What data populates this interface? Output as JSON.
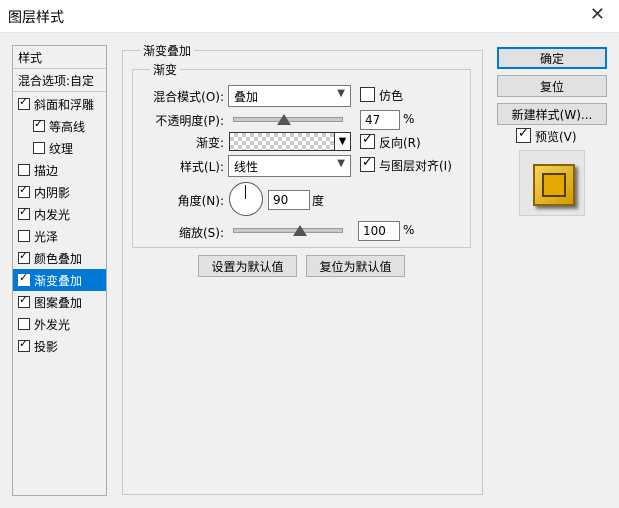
{
  "window": {
    "title": "图层样式",
    "close_icon": "close-icon"
  },
  "left": {
    "header": "样式",
    "blend_options": "混合选项:自定",
    "items": [
      {
        "label": "斜面和浮雕",
        "checked": true
      },
      {
        "label": "等高线",
        "checked": true
      },
      {
        "label": "纹理",
        "checked": false
      },
      {
        "label": "描边",
        "checked": false
      },
      {
        "label": "内阴影",
        "checked": true
      },
      {
        "label": "内发光",
        "checked": true
      },
      {
        "label": "光泽",
        "checked": false
      },
      {
        "label": "颜色叠加",
        "checked": true
      },
      {
        "label": "渐变叠加",
        "checked": true
      },
      {
        "label": "图案叠加",
        "checked": true
      },
      {
        "label": "外发光",
        "checked": false
      },
      {
        "label": "投影",
        "checked": true
      }
    ]
  },
  "main": {
    "outer_group": "渐变叠加",
    "inner_group": "渐变",
    "blend_mode_label": "混合模式(O):",
    "blend_mode_value": "叠加",
    "dither_label": "仿色",
    "opacity_label": "不透明度(P):",
    "opacity_value": "47",
    "opacity_unit": "%",
    "gradient_label": "渐变:",
    "reverse_label": "反向(R)",
    "style_label": "样式(L):",
    "style_value": "线性",
    "align_label": "与图层对齐(I)",
    "angle_label": "角度(N):",
    "angle_value": "90",
    "angle_unit": "度",
    "scale_label": "缩放(S):",
    "scale_value": "100",
    "scale_unit": "%",
    "set_default": "设置为默认值",
    "reset_default": "复位为默认值"
  },
  "right": {
    "ok": "确定",
    "reset": "复位",
    "new_style": "新建样式(W)...",
    "preview_label": "预览(V)"
  },
  "state": {
    "dither": false,
    "reverse": true,
    "align": true,
    "preview": true
  }
}
